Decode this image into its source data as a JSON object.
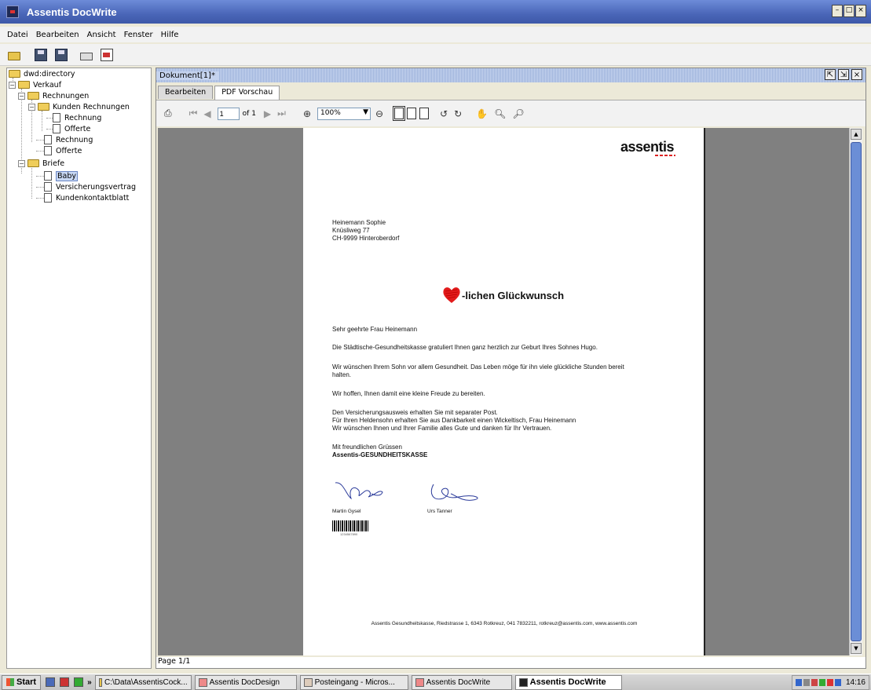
{
  "window": {
    "title": "Assentis DocWrite"
  },
  "menu": [
    "Datei",
    "Bearbeiten",
    "Ansicht",
    "Fenster",
    "Hilfe"
  ],
  "toolbar_icons": [
    "open-folder-icon",
    "save-icon",
    "save-all-icon",
    "print-icon",
    "pdf-document-icon"
  ],
  "tree": {
    "root": "dwd:directory",
    "verkauf": "Verkauf",
    "rechnungen": "Rechnungen",
    "kunden_rechnungen": "Kunden Rechnungen",
    "kr_rechnung": "Rechnung",
    "kr_offerte": "Offerte",
    "rechnung": "Rechnung",
    "offerte": "Offerte",
    "briefe": "Briefe",
    "baby": "Baby",
    "versicherungsvertrag": "Versicherungsvertrag",
    "kundenkontaktblatt": "Kundenkontaktblatt"
  },
  "document": {
    "title": "Dokument[1]*",
    "tabs": [
      "Bearbeiten",
      "PDF Vorschau"
    ],
    "active_tab": "PDF Vorschau",
    "page_input": "1",
    "page_of": "of 1",
    "zoom": "100%",
    "status": "Page 1/1"
  },
  "letter": {
    "logo": "assentis",
    "address": [
      "Heinemann Sophie",
      "Knüsliweg 77",
      "CH-9999 Hinteroberdorf"
    ],
    "headline": "-lichen Glückwunsch",
    "salutation": "Sehr geehrte Frau  Heinemann",
    "p1": "Die Städtische-Gesundheitskasse gratuliert Ihnen ganz herzlich zur Geburt Ihres Sohnes Hugo.",
    "p2a": "Wir wünschen Ihrem Sohn vor allem Gesundheit. Das Leben möge für ihn viele glückliche Stunden bereit",
    "p2b": "halten.",
    "p3": "Wir hoffen, Ihnen damit eine kleine Freude zu bereiten.",
    "p4a": "Den Versicherungsausweis erhalten Sie mit separater Post.",
    "p4b": "Für Ihren Heldensohn erhalten Sie aus Dankbarkeit einen Wickeltisch, Frau Heinemann",
    "p4c": "Wir wünschen Ihnen und Ihrer Familie alles Gute und danken für Ihr Vertrauen.",
    "closing": "Mit freundlichen Grüssen",
    "company": "Assentis-GESUNDHEITSKASSE",
    "signer1": "Martin Gysel",
    "signer2": "Urs Tanner",
    "barcode_number": "1234567890",
    "footer": "Assentis Gesundheitskasse, Riedstrasse 1, 6343 Rotkreuz, 041 7832211, rotkreuz@assentis.com, www.assentis.com"
  },
  "taskbar": {
    "start": "Start",
    "overflow": "»",
    "tasks": [
      "C:\\Data\\AssentisCock...",
      "Assentis DocDesign",
      "Posteingang - Micros...",
      "Assentis DocWrite",
      "Assentis DocWrite"
    ],
    "clock": "14:16"
  }
}
